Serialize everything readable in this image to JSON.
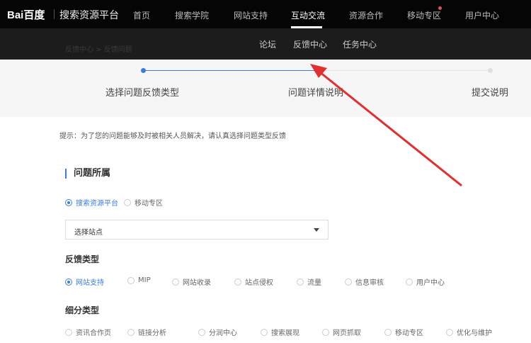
{
  "header": {
    "logo": "Bai百度",
    "platform": "搜索资源平台",
    "nav": [
      "首页",
      "搜索学院",
      "网站支持",
      "互动交流",
      "资源合作",
      "移动专区",
      "用户中心"
    ],
    "active": "互动交流"
  },
  "subnav": {
    "items": [
      "论坛",
      "反馈中心",
      "任务中心"
    ],
    "breadcrumb": "反馈中心 > 反馈问题"
  },
  "steps": [
    "选择问题反馈类型",
    "问题详情说明",
    "提交说明"
  ],
  "hint": "提示：为了您的问题能够及时被相关人员解决，请认真选择问题类型反馈",
  "section_title": "问题所属",
  "owner_options": [
    "搜索资源平台",
    "移动专区"
  ],
  "site_select": "选择站点",
  "feedback_label": "反馈类型",
  "feedback_options": [
    "网站支持",
    "MIP",
    "网站收录",
    "站点侵权",
    "流量",
    "信息审核",
    "用户中心"
  ],
  "sub_label": "细分类型",
  "sub_options": [
    "资讯合作页",
    "链接分析",
    "分润中心",
    "搜索展现",
    "网页抓取",
    "移动专区",
    "优化与维护"
  ],
  "colors": {
    "accent": "#3b7ddd",
    "arrow": "#e03030"
  }
}
